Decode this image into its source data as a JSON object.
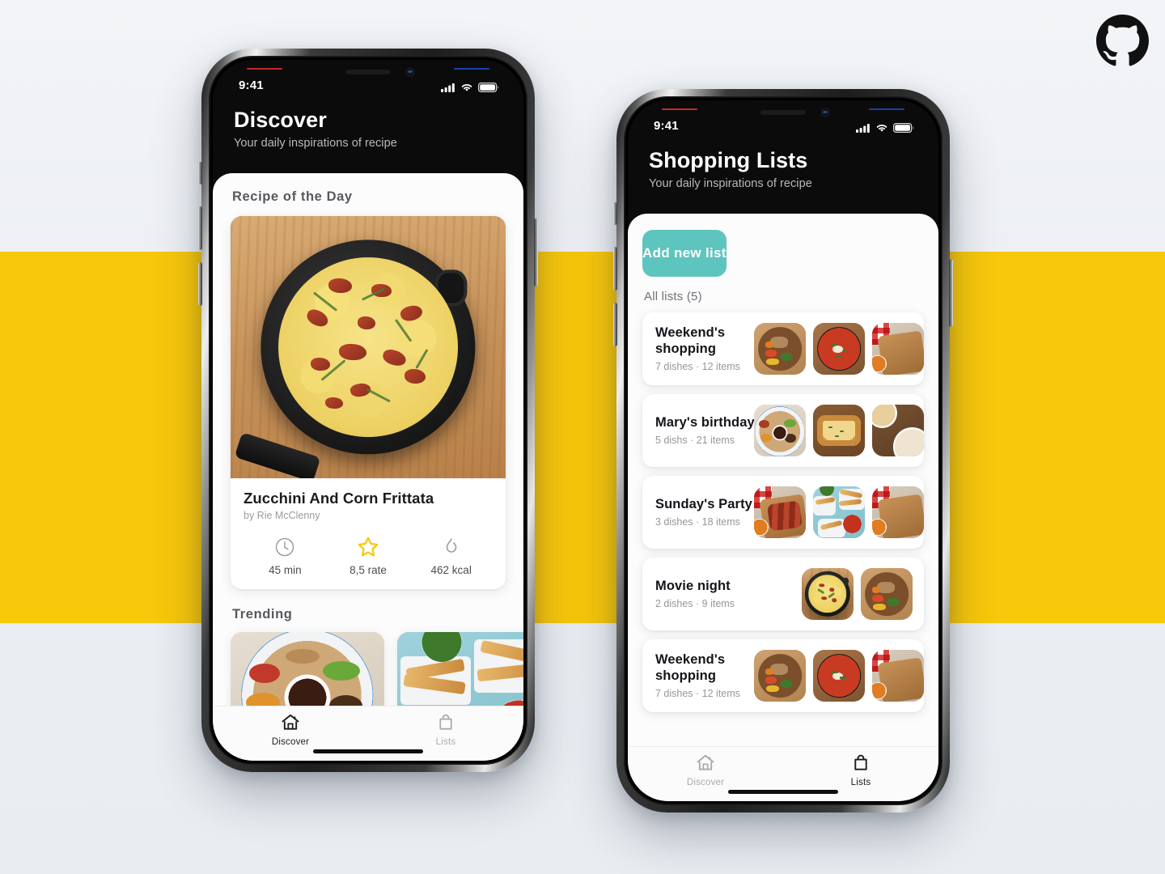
{
  "brand": {
    "logo_icon": "github-octocat-icon",
    "colors": {
      "background": "#eef1f5",
      "accent_band": "#f8c80b",
      "teal": "#5ec4be",
      "star_yellow": "#f8c80b",
      "sheet": "#fcfcfc"
    }
  },
  "phones": [
    {
      "id": "discover",
      "status_bar": {
        "time": "9:41",
        "icons": [
          "cellular-signal-icon",
          "wifi-icon",
          "battery-icon"
        ]
      },
      "header": {
        "title": "Discover",
        "subtitle": "Your daily inspirations of recipe"
      },
      "recipe_of_the_day": {
        "section_title": "Recipe of the Day",
        "photo_alt": "zucchini-corn-frittata-skillet",
        "name": "Zucchini And Corn Frittata",
        "author": "by Rie McClenny",
        "stats": [
          {
            "icon": "clock-icon",
            "value": "45 min"
          },
          {
            "icon": "star-icon",
            "value": "8,5 rate"
          },
          {
            "icon": "flame-icon",
            "value": "462 kcal"
          }
        ]
      },
      "trending": {
        "section_title": "Trending",
        "cards": [
          {
            "photo_alt": "ethiopian-platter-blue-plate"
          },
          {
            "photo_alt": "corn-dogs-with-salsa"
          }
        ]
      },
      "tabs": [
        {
          "label": "Discover",
          "icon": "home-icon",
          "active": true
        },
        {
          "label": "Lists",
          "icon": "shopping-bag-icon",
          "active": false
        }
      ]
    },
    {
      "id": "lists",
      "status_bar": {
        "time": "9:41",
        "icons": [
          "cellular-signal-icon",
          "wifi-icon",
          "battery-icon"
        ]
      },
      "header": {
        "title": "Shopping Lists",
        "subtitle": "Your daily inspirations of recipe"
      },
      "add_button_label": "Add new list",
      "all_lists_label": "All lists (5)",
      "lists": [
        {
          "name": "Weekend's shopping",
          "meta": "7 dishes · 12 items",
          "thumbs": [
            "rice-bowl",
            "tomato-skillet",
            "picnic-board"
          ]
        },
        {
          "name": "Mary's birthday",
          "meta": "5 dishs · 21 items",
          "thumbs": [
            "ethiopian-platter",
            "baked-lasagna",
            "soup-bowls"
          ]
        },
        {
          "name": "Sunday's Party",
          "meta": "3 dishes · 18 items",
          "thumbs": [
            "ribs-board",
            "corn-dogs-salsa",
            "picnic-board"
          ]
        },
        {
          "name": "Movie night",
          "meta": "2 dishes · 9 items",
          "thumbs": [
            "frittata-skillet",
            "rice-bowl"
          ]
        },
        {
          "name": "Weekend's shopping",
          "meta": "7 dishes · 12 items",
          "thumbs": [
            "rice-bowl",
            "tomato-skillet",
            "picnic-board"
          ]
        }
      ],
      "tabs": [
        {
          "label": "Discover",
          "icon": "home-icon",
          "active": false
        },
        {
          "label": "Lists",
          "icon": "shopping-bag-icon",
          "active": true
        }
      ]
    }
  ]
}
